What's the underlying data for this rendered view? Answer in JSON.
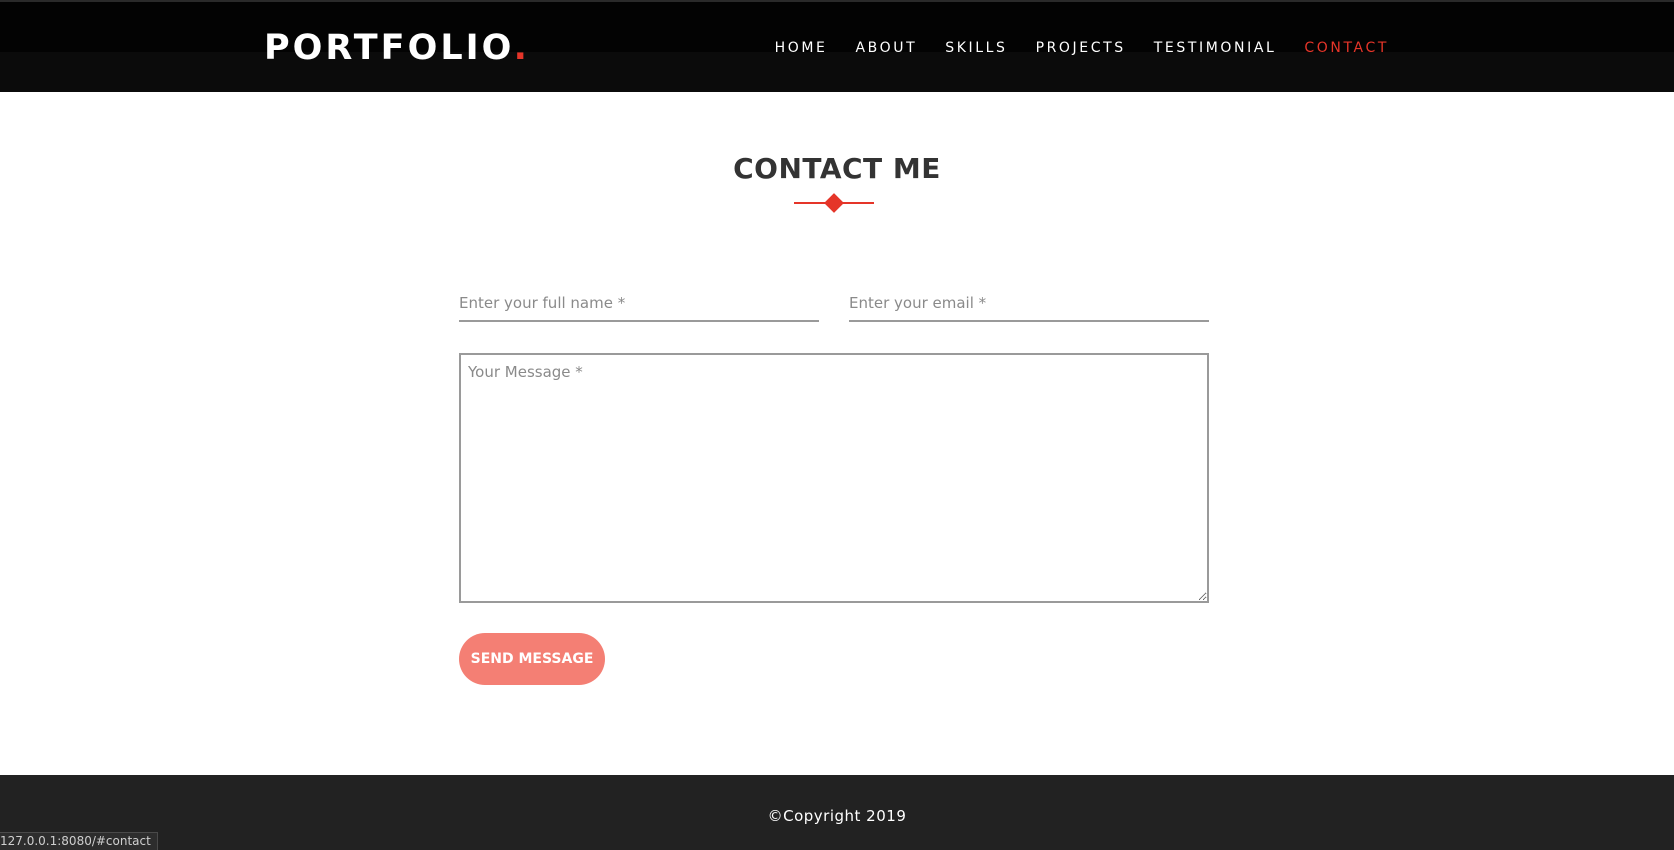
{
  "header": {
    "logo_text": "PORTFOLIO",
    "logo_dot": ".",
    "nav": [
      {
        "label": "HOME",
        "active": false
      },
      {
        "label": "ABOUT",
        "active": false
      },
      {
        "label": "SKILLS",
        "active": false
      },
      {
        "label": "PROJECTS",
        "active": false
      },
      {
        "label": "TESTIMONIAL",
        "active": false
      },
      {
        "label": "CONTACT",
        "active": true
      }
    ]
  },
  "contact": {
    "title": "CONTACT ME",
    "name_placeholder": "Enter your full name *",
    "email_placeholder": "Enter your email *",
    "message_placeholder": "Your Message *",
    "send_label": "SEND MESSAGE"
  },
  "footer": {
    "copyright": "©Copyright 2019"
  },
  "status_bar": {
    "url": "127.0.0.1:8080/#contact"
  },
  "colors": {
    "accent": "#e53529",
    "button": "#f47f74",
    "navbar": "#0b0b0b",
    "footer": "#222222"
  }
}
